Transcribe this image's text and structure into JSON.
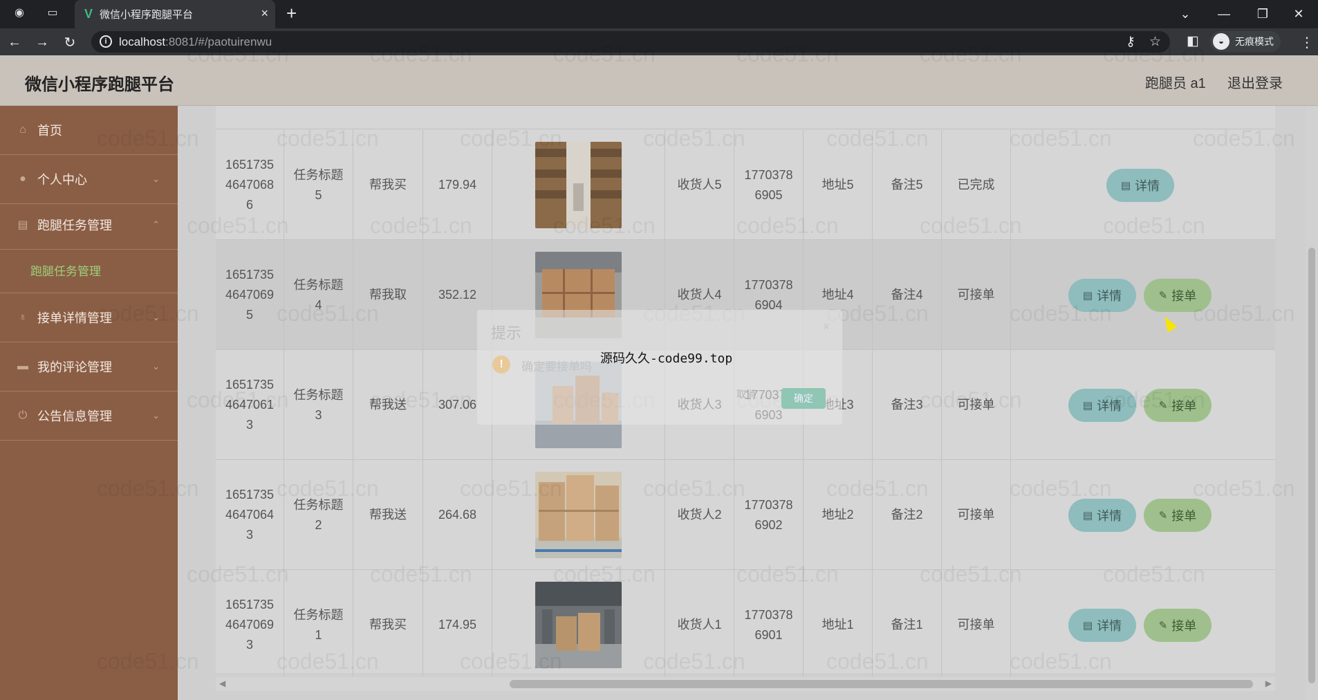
{
  "browser": {
    "tab_title": "微信小程序跑腿平台",
    "url_host": "localhost",
    "url_rest": ":8081/#/paotuirenwu",
    "incognito_label": "无痕模式"
  },
  "header": {
    "title": "微信小程序跑腿平台",
    "user": "跑腿员 a1",
    "logout": "退出登录"
  },
  "sidebar": {
    "items": [
      {
        "label": "首页",
        "icon": "home-icon"
      },
      {
        "label": "个人中心",
        "icon": "user-icon"
      },
      {
        "label": "跑腿任务管理",
        "icon": "list-icon"
      },
      {
        "label": "接单详情管理",
        "icon": "mic-icon"
      },
      {
        "label": "我的评论管理",
        "icon": "chat-icon"
      },
      {
        "label": "公告信息管理",
        "icon": "power-icon"
      }
    ],
    "active_sub": "跑腿任务管理"
  },
  "table": {
    "rows": [
      {
        "id_l1": "1651735",
        "id_l2": "4647068",
        "id_l3": "6",
        "title_l1": "任务标题",
        "title_l2": "5",
        "type": "帮我买",
        "price": "179.94",
        "receiver": "收货人5",
        "phone_l1": "1770378",
        "phone_l2": "6905",
        "address": "地址5",
        "remark": "备注5",
        "status": "已完成",
        "detail": "详情",
        "take": ""
      },
      {
        "id_l1": "1651735",
        "id_l2": "4647069",
        "id_l3": "5",
        "title_l1": "任务标题",
        "title_l2": "4",
        "type": "帮我取",
        "price": "352.12",
        "receiver": "收货人4",
        "phone_l1": "1770378",
        "phone_l2": "6904",
        "address": "地址4",
        "remark": "备注4",
        "status": "可接单",
        "detail": "详情",
        "take": "接单"
      },
      {
        "id_l1": "1651735",
        "id_l2": "4647061",
        "id_l3": "3",
        "title_l1": "任务标题",
        "title_l2": "3",
        "type": "帮我送",
        "price": "307.06",
        "receiver": "收货人3",
        "phone_l1": "1770378",
        "phone_l2": "6903",
        "address": "地址3",
        "remark": "备注3",
        "status": "可接单",
        "detail": "详情",
        "take": "接单"
      },
      {
        "id_l1": "1651735",
        "id_l2": "4647064",
        "id_l3": "3",
        "title_l1": "任务标题",
        "title_l2": "2",
        "type": "帮我送",
        "price": "264.68",
        "receiver": "收货人2",
        "phone_l1": "1770378",
        "phone_l2": "6902",
        "address": "地址2",
        "remark": "备注2",
        "status": "可接单",
        "detail": "详情",
        "take": "接单"
      },
      {
        "id_l1": "1651735",
        "id_l2": "4647069",
        "id_l3": "3",
        "title_l1": "任务标题",
        "title_l2": "1",
        "type": "帮我买",
        "price": "174.95",
        "receiver": "收货人1",
        "phone_l1": "1770378",
        "phone_l2": "6901",
        "address": "地址1",
        "remark": "备注1",
        "status": "可接单",
        "detail": "详情",
        "take": "接单"
      }
    ]
  },
  "dialog": {
    "title": "提示",
    "close": "×",
    "message": "确定要接单吗",
    "cancel": "取消",
    "ok": "确定"
  },
  "overlay_text": "源码久久-code99.top",
  "watermark": "code51.cn"
}
